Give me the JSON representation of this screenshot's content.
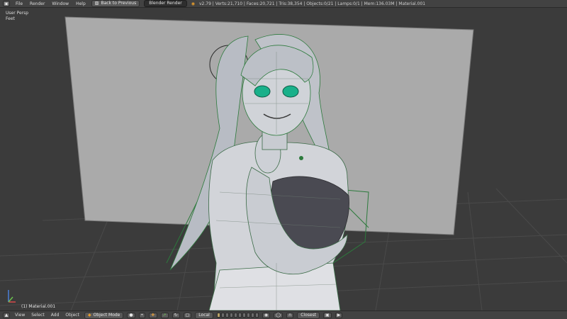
{
  "topbar": {
    "menus": [
      "File",
      "Render",
      "Window",
      "Help"
    ],
    "back_button": "Back to Previous",
    "render_engine": "Blender Render",
    "stats": "v2.79 | Verts:21,710 | Faces:20,721 | Tris:38,354 | Objects:0/21 | Lamps:0/1 | Mem:136.03M | Material.001"
  },
  "viewport": {
    "view_name": "User Persp",
    "units": "Feet",
    "object_label": "(1) Material.001"
  },
  "bottombar": {
    "menus": [
      "View",
      "Select",
      "Add",
      "Object"
    ],
    "mode": "Object Mode",
    "orientation": "Local",
    "snap_target": "Closest"
  },
  "colors": {
    "wire": "#2c7a3c",
    "mesh": "#cfd1d6",
    "backdrop": "#a9a9a9",
    "eye": "#19b08a"
  }
}
